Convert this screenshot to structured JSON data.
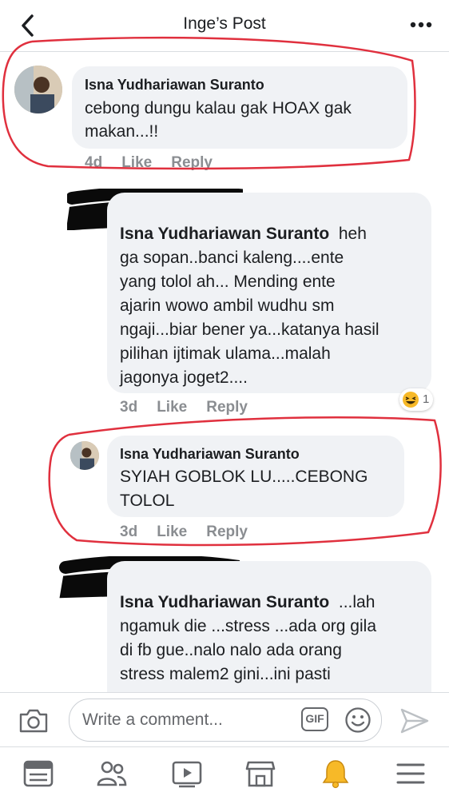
{
  "header": {
    "title": "Inge’s Post",
    "back_icon": "chevron-left-icon",
    "more_icon": "more-dots-icon"
  },
  "comments": [
    {
      "author": "Isna Yudhariawan Suranto",
      "text_line1": "cebong dungu kalau gak HOAX gak",
      "text_line2": "makan...!!",
      "time": "4d",
      "like": "Like",
      "reply": "Reply"
    },
    {
      "author": "Isna Yudhariawan Suranto",
      "text_lines": [
        "heh",
        "ga sopan..banci kaleng....ente",
        "yang tolol ah... Mending ente",
        "ajarin wowo ambil wudhu sm",
        "ngaji...biar bener ya...katanya hasil",
        "pilihan ijtimak ulama...malah",
        "jagonya joget2...."
      ],
      "time": "3d",
      "like": "Like",
      "reply": "Reply",
      "reaction_count": "1",
      "reaction_icon": "laughing-emoji-icon"
    },
    {
      "author": "Isna Yudhariawan Suranto",
      "text_line1": "SYIAH GOBLOK LU.....CEBONG",
      "text_line2": "TOLOL",
      "time": "3d",
      "like": "Like",
      "reply": "Reply"
    },
    {
      "author": "Isna Yudhariawan Suranto",
      "text_lines": [
        "...lah",
        "ngamuk die ...stress ...ada org gila",
        "di fb gue..nalo nalo ada orang",
        "stress malem2 gini...ini pasti"
      ]
    }
  ],
  "composer": {
    "placeholder": "Write a comment...",
    "gif_label": "GIF",
    "camera_icon": "camera-icon",
    "emoji_icon": "smiley-icon",
    "send_icon": "send-icon"
  },
  "bottom_nav": [
    "news-feed-icon",
    "friends-icon",
    "watch-icon",
    "marketplace-icon",
    "notifications-bell-icon",
    "menu-icon"
  ],
  "colors": {
    "annotation_red": "#e0303e",
    "bubble_bg": "#f0f2f5",
    "meta_gray": "#8a8d91",
    "bell_yellow": "#f7b928"
  }
}
